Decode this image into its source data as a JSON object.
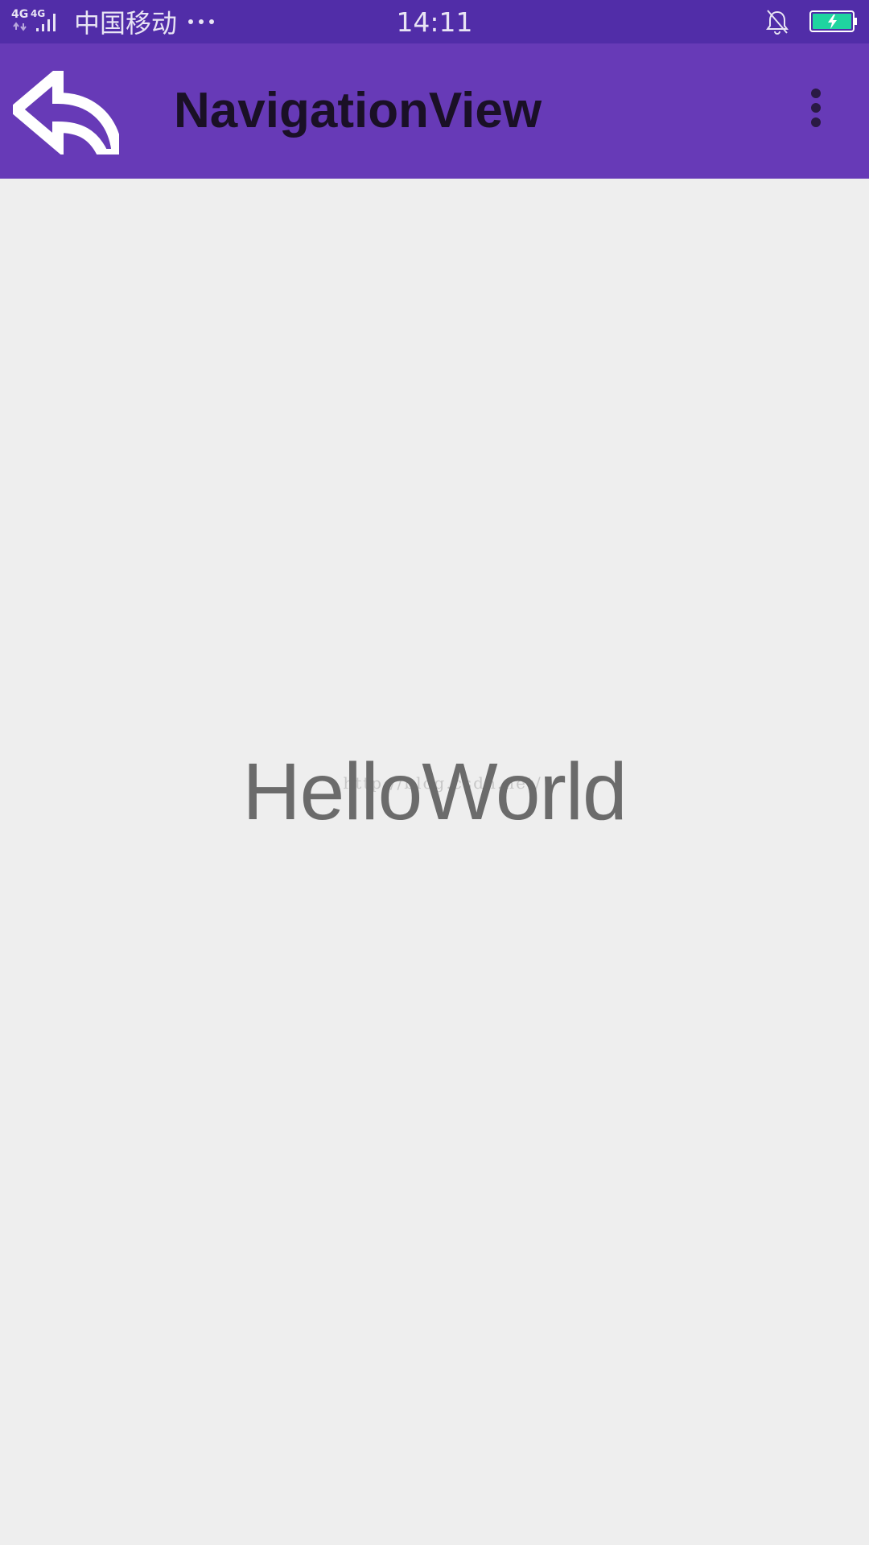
{
  "status_bar": {
    "network_label_1": "4G",
    "network_label_2": "4G",
    "carrier": "中国移动",
    "time": "14:11",
    "icons": [
      "signal-icon",
      "more-notifications-icon",
      "bell-off-icon",
      "battery-charging-icon"
    ],
    "battery_color": "#1fd4a0"
  },
  "toolbar": {
    "title": "NavigationView",
    "back_icon": "back-arrow-icon",
    "overflow_icon": "more-vert-icon",
    "background": "#673ab7"
  },
  "content": {
    "text": "HelloWorld",
    "watermark": "http://blog.csdn.net/"
  },
  "colors": {
    "status_bar": "#512da8",
    "toolbar": "#673ab7",
    "background": "#eeeeee"
  }
}
